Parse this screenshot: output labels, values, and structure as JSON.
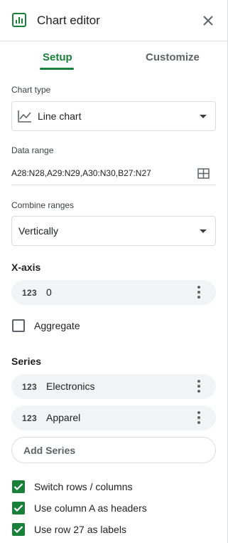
{
  "header": {
    "title": "Chart editor",
    "logo_icon": "sheets-chart-icon",
    "close_icon": "close-icon"
  },
  "tabs": [
    {
      "label": "Setup",
      "active": true
    },
    {
      "label": "Customize",
      "active": false
    }
  ],
  "chart_type": {
    "label": "Chart type",
    "value": "Line chart",
    "icon": "line-chart-icon"
  },
  "data_range": {
    "label": "Data range",
    "value": "A28:N28,A29:N29,A30:N30,B27:N27",
    "icon": "grid-icon"
  },
  "combine_ranges": {
    "label": "Combine ranges",
    "value": "Vertically"
  },
  "x_axis": {
    "title": "X-axis",
    "item": {
      "type_icon": "123",
      "label": "0"
    }
  },
  "aggregate": {
    "label": "Aggregate",
    "checked": false
  },
  "series": {
    "title": "Series",
    "items": [
      {
        "type_icon": "123",
        "label": "Electronics"
      },
      {
        "type_icon": "123",
        "label": "Apparel"
      }
    ],
    "add_label": "Add Series"
  },
  "options": [
    {
      "label": "Switch rows / columns",
      "checked": true
    },
    {
      "label": "Use column A as headers",
      "checked": true
    },
    {
      "label": "Use row 27 as labels",
      "checked": true
    }
  ],
  "colors": {
    "accent": "#188038",
    "pill_bg": "#f1f3f4",
    "border": "#dadce0"
  }
}
